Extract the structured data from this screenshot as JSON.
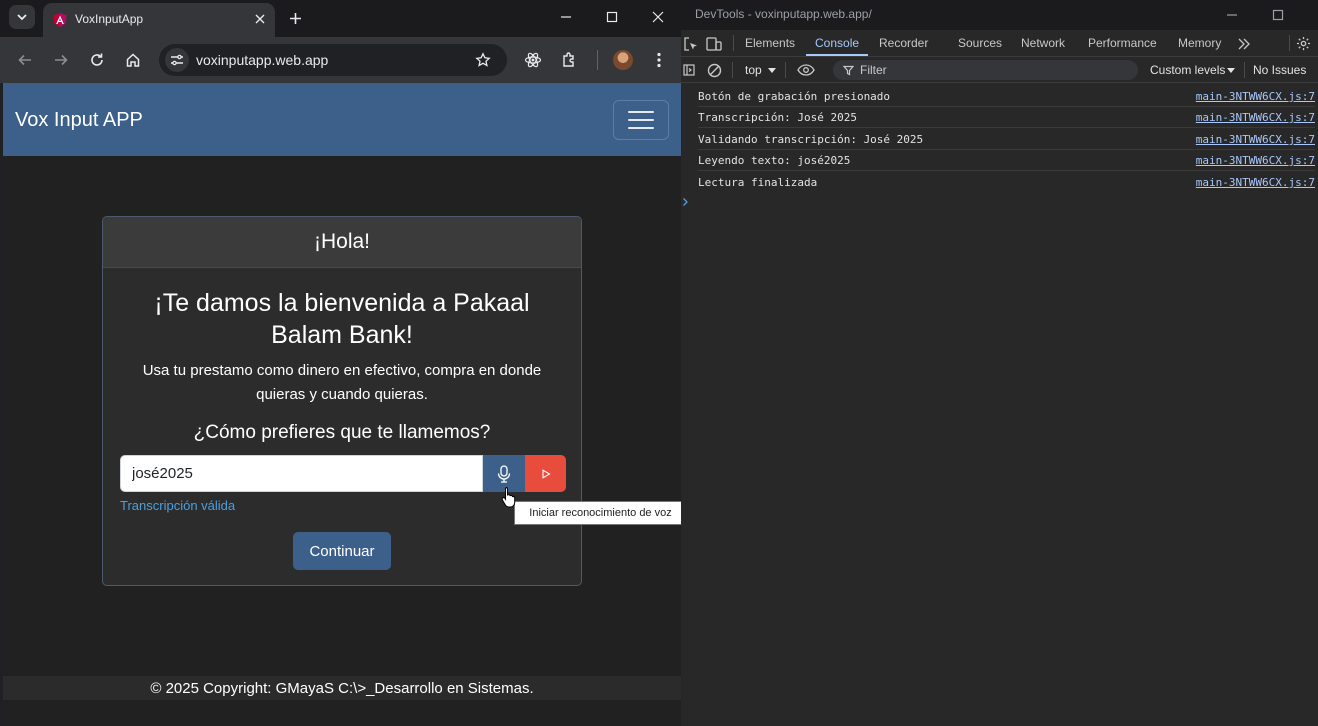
{
  "browser": {
    "tab_title": "VoxInputApp",
    "url": "voxinputapp.web.app"
  },
  "app": {
    "brand": "Vox Input APP",
    "card": {
      "header": "¡Hola!",
      "title": "¡Te damos la bienvenida a Pakaal Balam Bank!",
      "text": "Usa tu prestamo como dinero en efectivo, compra en donde quieras y cuando quieras.",
      "question": "¿Cómo prefieres que te llamemos?",
      "input_value": "josé2025",
      "valid_message": "Transcripción válida",
      "continue_label": "Continuar"
    },
    "tooltip": "Iniciar reconocimiento de voz",
    "footer": "© 2025 Copyright: GMayaS C:\\>_Desarrollo en Sistemas."
  },
  "devtools": {
    "window_title": "DevTools - voxinputapp.web.app/",
    "tabs": [
      "Elements",
      "Console",
      "Recorder",
      "Sources",
      "Network",
      "Performance",
      "Memory"
    ],
    "active_tab": "Console",
    "context": "top",
    "filter_placeholder": "Filter",
    "levels": "Custom levels",
    "issues": "No Issues",
    "logs": [
      {
        "message": "Botón de grabación presionado",
        "source": "main-3NTWW6CX.js:7"
      },
      {
        "message": "Transcripción: José 2025",
        "source": "main-3NTWW6CX.js:7"
      },
      {
        "message": "Validando transcripción: José 2025",
        "source": "main-3NTWW6CX.js:7"
      },
      {
        "message": "Leyendo texto: josé2025",
        "source": "main-3NTWW6CX.js:7"
      },
      {
        "message": "Lectura finalizada",
        "source": "main-3NTWW6CX.js:7"
      }
    ]
  },
  "colors": {
    "navbar": "#3c6089",
    "play_button": "#e74c3c",
    "valid_text": "#4a9fe0",
    "devtools_accent": "#a8c7fa"
  }
}
